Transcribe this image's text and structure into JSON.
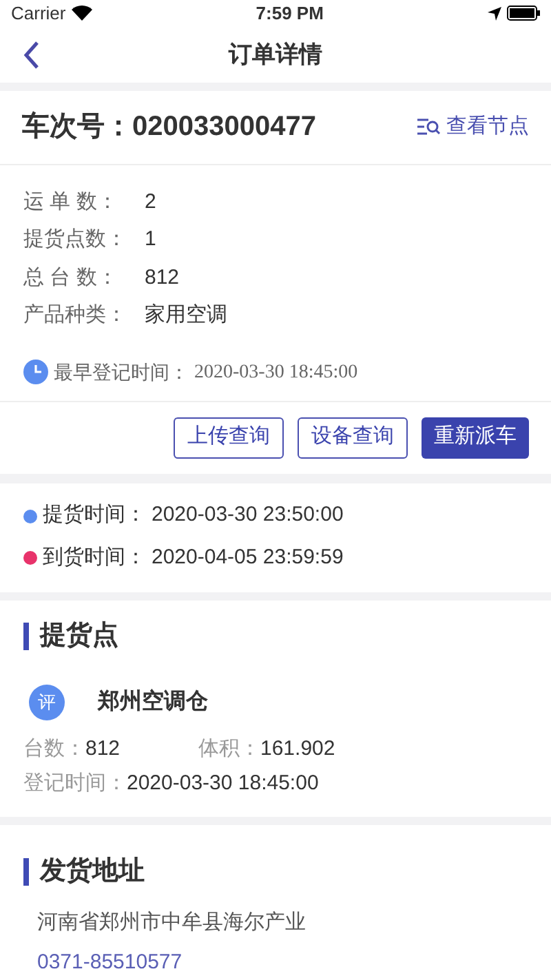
{
  "status_bar": {
    "carrier": "Carrier",
    "time": "7:59 PM"
  },
  "nav": {
    "title": "订单详情"
  },
  "trip": {
    "label": "车次号：",
    "number": "020033000477",
    "action": "查看节点"
  },
  "info": [
    {
      "label": "运 单 数：",
      "value": "2"
    },
    {
      "label": "提货点数：",
      "value": "1"
    },
    {
      "label": "总 台 数：",
      "value": "812"
    },
    {
      "label": "产品种类：",
      "value": "家用空调"
    }
  ],
  "earliest": {
    "label": "最早登记时间：",
    "value": "2020-03-30 18:45:00"
  },
  "buttons": [
    {
      "label": "上传查询",
      "kind": "outline"
    },
    {
      "label": "设备查询",
      "kind": "outline"
    },
    {
      "label": "重新派车",
      "kind": "filled"
    }
  ],
  "timeline": [
    {
      "label": "提货时间：",
      "value": "2020-03-30 23:50:00",
      "color": "#5b8def"
    },
    {
      "label": "到货时间：",
      "value": "2020-04-05 23:59:59",
      "color": "#e8336b"
    }
  ],
  "pickup": {
    "heading": "提货点",
    "badge": "评",
    "name": "郑州空调仓",
    "count_label": "台数：",
    "count": "812",
    "volume_label": "体积：",
    "volume": "161.902",
    "time_label": "登记时间：",
    "time": "2020-03-30 18:45:00"
  },
  "shipping": {
    "heading": "发货地址",
    "address": "河南省郑州市中牟县海尔产业",
    "phone": "0371-85510577"
  }
}
